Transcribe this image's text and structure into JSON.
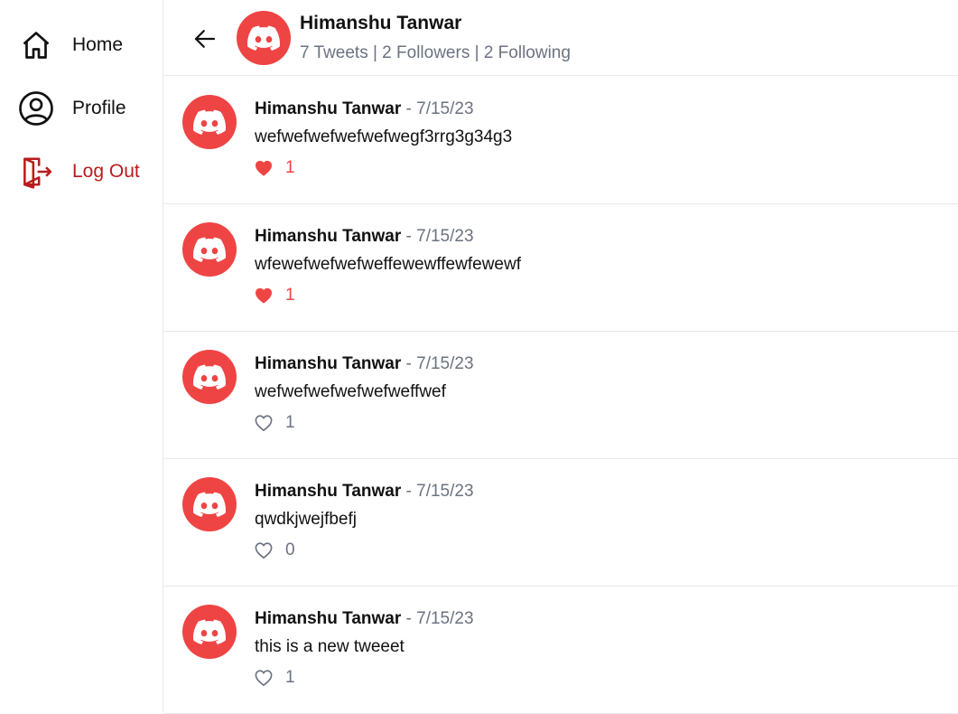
{
  "sidebar": {
    "items": [
      {
        "label": "Home",
        "icon": "home-icon"
      },
      {
        "label": "Profile",
        "icon": "profile-icon"
      },
      {
        "label": "Log Out",
        "icon": "logout-icon"
      }
    ]
  },
  "header": {
    "name": "Himanshu Tanwar",
    "stats": "7 Tweets | 2 Followers | 2 Following",
    "back_icon": "arrow-left-icon",
    "avatar_icon": "discord-logo-icon"
  },
  "tweets": [
    {
      "author": "Himanshu Tanwar",
      "date": "- 7/15/23",
      "text": "wefwefwefwefwefwegf3rrg3g34g3",
      "likes": "1",
      "liked": true
    },
    {
      "author": "Himanshu Tanwar",
      "date": "- 7/15/23",
      "text": "wfewefwefwefweffewewffewfewewf",
      "likes": "1",
      "liked": true
    },
    {
      "author": "Himanshu Tanwar",
      "date": "- 7/15/23",
      "text": "wefwefwefwefwefweffwef",
      "likes": "1",
      "liked": false
    },
    {
      "author": "Himanshu Tanwar",
      "date": "- 7/15/23",
      "text": "qwdkjwejfbefj",
      "likes": "0",
      "liked": false
    },
    {
      "author": "Himanshu Tanwar",
      "date": "- 7/15/23",
      "text": "this is a new tweeet",
      "likes": "1",
      "liked": false
    }
  ],
  "colors": {
    "accent": "#ef4444",
    "logout": "#b91c1c",
    "muted": "#6b7280"
  }
}
